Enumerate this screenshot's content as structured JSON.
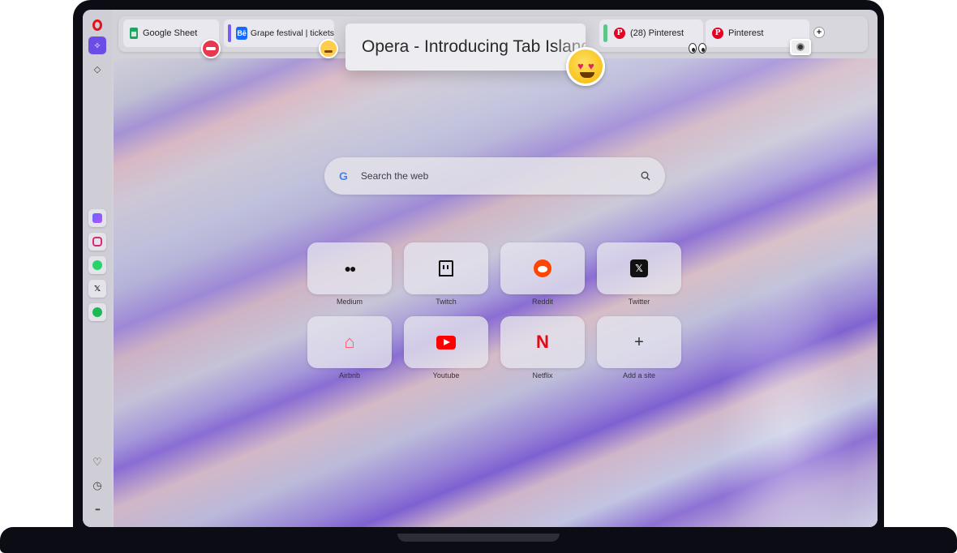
{
  "tabs": {
    "google_sheet": "Google Sheet",
    "grape_festival": "Grape festival | tickets",
    "active": "Opera - Introducing Tab Islands",
    "pinterest_1": "(28) Pinterest",
    "pinterest_2": "Pinterest",
    "new_tab": "+"
  },
  "search": {
    "placeholder": "Search the web",
    "engine_logo": "G"
  },
  "speed_dials": [
    {
      "label": "Medium",
      "icon": "medium-icon",
      "glyph": "●●"
    },
    {
      "label": "Twitch",
      "icon": "twitch-icon",
      "glyph": ""
    },
    {
      "label": "Reddit",
      "icon": "reddit-icon",
      "glyph": ""
    },
    {
      "label": "Twitter",
      "icon": "x-icon",
      "glyph": "𝕏"
    },
    {
      "label": "Airbnb",
      "icon": "airbnb-icon",
      "glyph": "⌂"
    },
    {
      "label": "Youtube",
      "icon": "youtube-icon",
      "glyph": ""
    },
    {
      "label": "Netflix",
      "icon": "netflix-icon",
      "glyph": "N"
    },
    {
      "label": "Add a site",
      "icon": "plus-icon",
      "glyph": "+"
    }
  ],
  "sidebar": {
    "top": [
      "opera-logo",
      "aria-icon",
      "diamond-icon"
    ],
    "apps": [
      "opera-icon",
      "instagram-icon",
      "whatsapp-icon",
      "x-icon",
      "spotify-icon"
    ],
    "bottom": [
      "heart-icon",
      "clock-icon",
      "more-icon"
    ],
    "glyphs": {
      "diamond": "◇",
      "x": "𝕏",
      "heart": "♡",
      "clock": "◷",
      "more": "•••",
      "aria": "✧"
    }
  },
  "colors": {
    "island_purple": "#7b5cf0",
    "island_green": "#5fc48a",
    "opera_red": "#e3131b",
    "aria_bg": "#6b4ce6"
  }
}
